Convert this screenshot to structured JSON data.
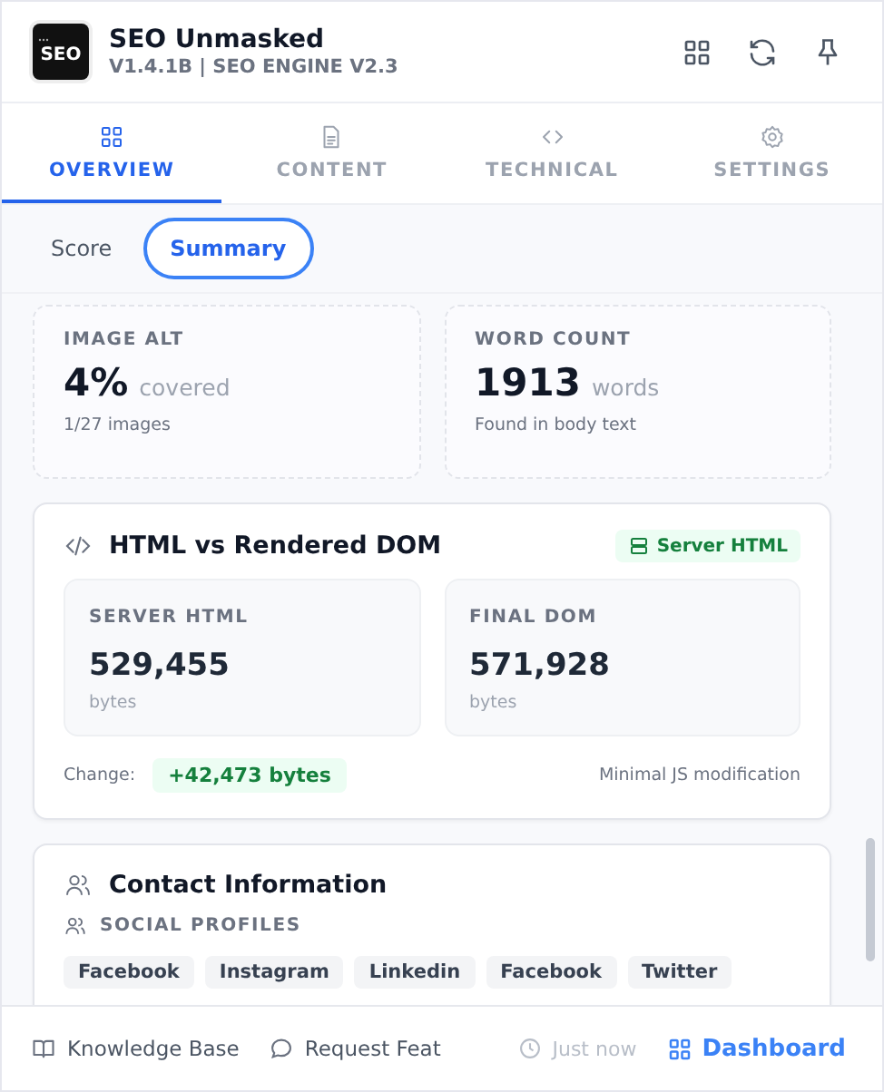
{
  "app": {
    "logo": "SEO",
    "title": "SEO Unmasked",
    "version": "V1.4.1B | SEO ENGINE V2.3"
  },
  "tabs": [
    {
      "label": "OVERVIEW",
      "selected": true
    },
    {
      "label": "CONTENT",
      "selected": false
    },
    {
      "label": "TECHNICAL",
      "selected": false
    },
    {
      "label": "SETTINGS",
      "selected": false
    }
  ],
  "subtabs": [
    {
      "label": "Score",
      "selected": false
    },
    {
      "label": "Summary",
      "selected": true
    }
  ],
  "stat_cards": [
    {
      "label": "IMAGE ALT",
      "value": "4%",
      "unit": "covered",
      "note": "1/27 images"
    },
    {
      "label": "WORD COUNT",
      "value": "1913",
      "unit": "words",
      "note": "Found in body text"
    }
  ],
  "html_dom": {
    "title": "HTML vs Rendered DOM",
    "badge": "Server HTML",
    "panels": [
      {
        "label": "SERVER HTML",
        "value": "529,455",
        "unit": "bytes"
      },
      {
        "label": "FINAL DOM",
        "value": "571,928",
        "unit": "bytes"
      }
    ],
    "change_label": "Change:",
    "change_value": "+42,473 bytes",
    "note": "Minimal JS modification"
  },
  "contact": {
    "title": "Contact Information",
    "section": "SOCIAL PROFILES",
    "profiles": [
      "Facebook",
      "Instagram",
      "Linkedin",
      "Facebook",
      "Twitter"
    ]
  },
  "footer": {
    "links": [
      "Knowledge Base",
      "Request Feat"
    ],
    "time": "Just now",
    "dashboard": "Dashboard"
  }
}
